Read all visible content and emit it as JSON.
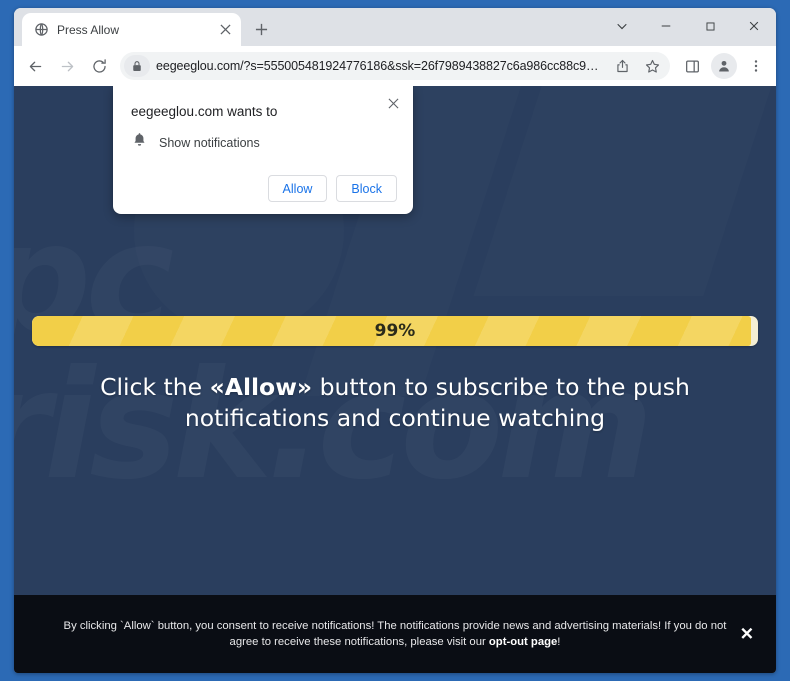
{
  "browser": {
    "tab": {
      "title": "Press Allow",
      "favicon": "globe-icon",
      "close_label": "×"
    },
    "new_tab_label": "+",
    "window_controls": {
      "tab_search": "⌄",
      "minimize": "–",
      "maximize": "□",
      "close": "×"
    },
    "nav": {
      "back": "←",
      "forward": "→",
      "reload": "↻"
    },
    "omnibox": {
      "url": "eegeeglou.com/?s=555005481924776186&ssk=26f7989438827c6a986cc88c98…",
      "lock_icon": "lock-icon",
      "share_icon": "share-icon",
      "bookmark_icon": "star-icon"
    },
    "toolbar": {
      "side_panel_icon": "side-panel-icon",
      "profile_icon": "profile-avatar-icon",
      "menu_icon": "three-dot-menu-icon"
    }
  },
  "permission_dialog": {
    "title": "eegeeglou.com wants to",
    "permission_label": "Show notifications",
    "permission_icon": "bell-icon",
    "allow_label": "Allow",
    "block_label": "Block",
    "close_label": "×"
  },
  "page": {
    "background_color": "#2a3e5e",
    "watermark_line1": "pc",
    "watermark_line2": "risk.com",
    "progress": {
      "percent_label": "99%",
      "percent_value": 99,
      "track_color": "#f4efd4",
      "fill_color": "#f2cf48"
    },
    "headline": {
      "prefix": "Click the ",
      "emphasis": "«Allow»",
      "suffix": " button to subscribe to the push notifications and continue watching"
    },
    "consent_bar": {
      "text_part1": "By clicking `Allow` button, you consent to receive notifications! The notifications provide news and advertising materials! If you do not agree to receive these notifications, please visit our ",
      "link_label": "opt-out page",
      "text_part2": "!",
      "close_label": "✕",
      "background_color": "#0a0d14"
    }
  }
}
